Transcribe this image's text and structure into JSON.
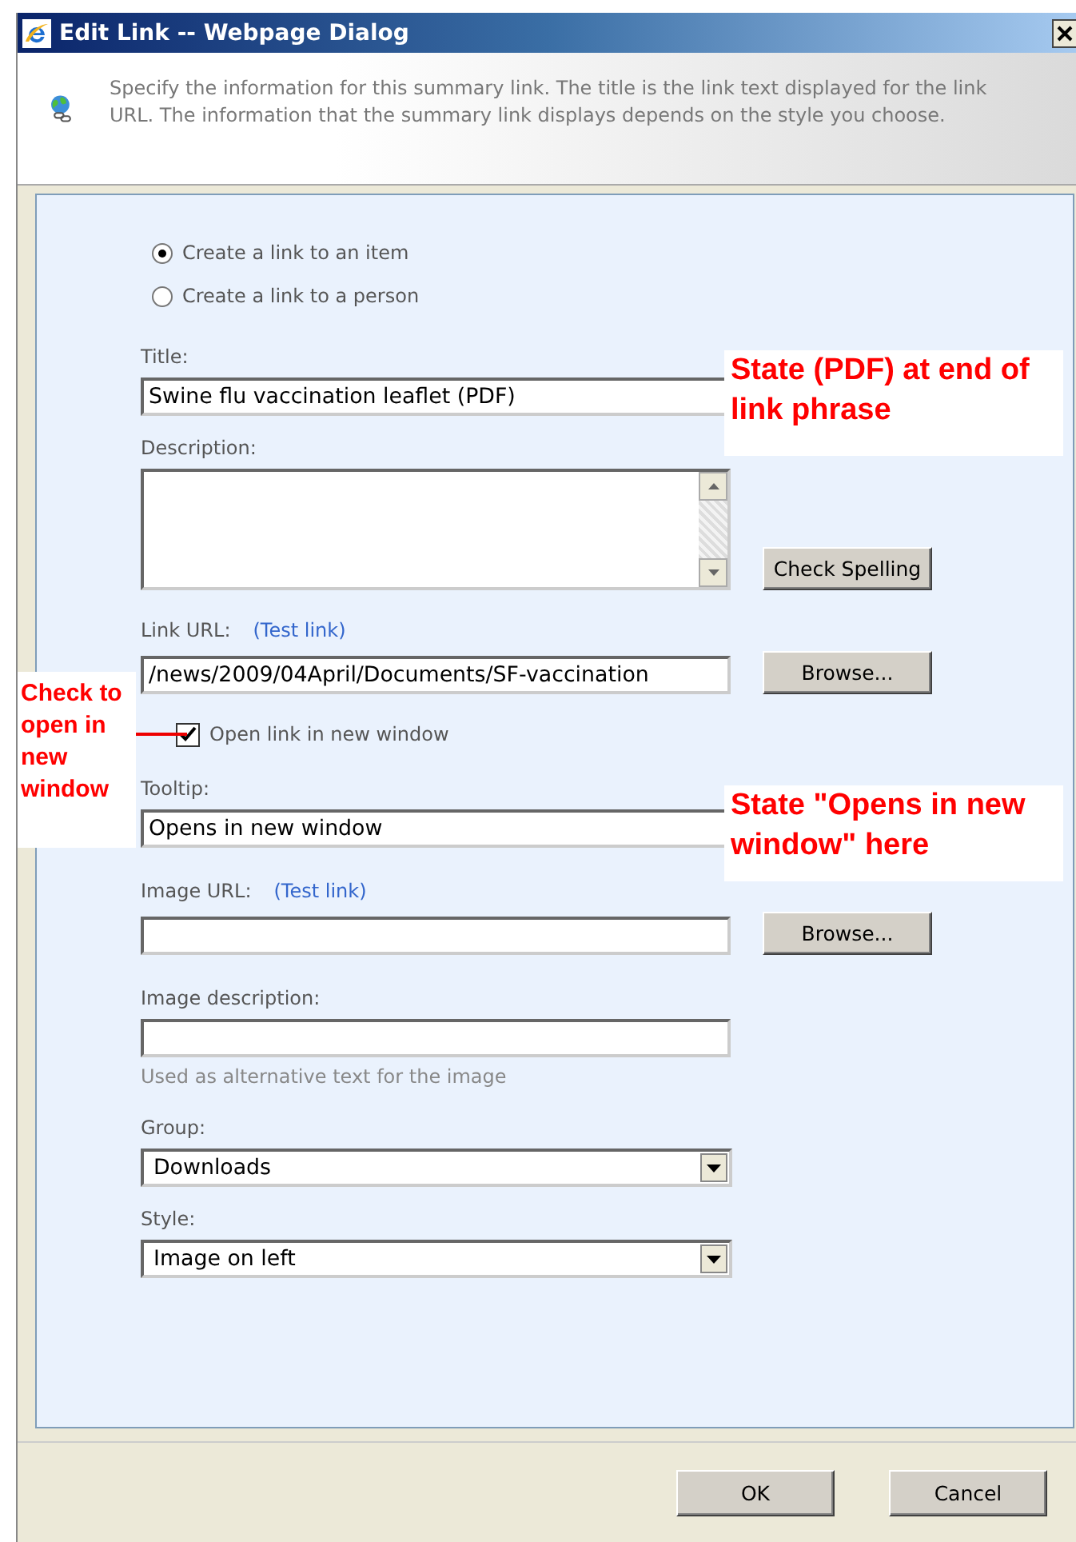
{
  "window": {
    "title": "Edit Link -- Webpage Dialog"
  },
  "header": {
    "text": "Specify the information for this summary link. The title is the link text displayed for the link URL. The information that the summary link displays depends on the style you choose."
  },
  "form": [
    {
      "kind": "radio",
      "label": "Create a link to an item",
      "selected": true
    },
    {
      "kind": "radio",
      "label": "Create a link to a person",
      "selected": false
    },
    {
      "kind": "text",
      "label": "Title:",
      "value": "Swine flu vaccination leaflet (PDF)"
    },
    {
      "kind": "textarea",
      "label": "Description:",
      "button": "Check Spelling"
    },
    {
      "kind": "text",
      "label": "Link URL:",
      "link": "(Test link)",
      "value": "/news/2009/04April/Documents/SF-vaccination",
      "button": "Browse..."
    },
    {
      "kind": "checkbox",
      "label": "Open link in new window",
      "checked": true
    },
    {
      "kind": "text",
      "label": "Tooltip:",
      "value": "Opens in new window"
    },
    {
      "kind": "text",
      "label": "Image URL:",
      "link": "(Test link)",
      "button": "Browse..."
    },
    {
      "kind": "text",
      "label": "Image description:",
      "hint": "Used as alternative text for the image"
    },
    {
      "kind": "select",
      "label": "Group:",
      "value": "Downloads"
    },
    {
      "kind": "select",
      "label": "Style:",
      "value": "Image on left"
    }
  ],
  "annotations": [
    {
      "text": "State (PDF) at end of link phrase"
    },
    {
      "text": "Check to open in new window"
    },
    {
      "text": "State \"Opens in new window\" here"
    }
  ],
  "buttons": [
    "OK",
    "Cancel"
  ]
}
